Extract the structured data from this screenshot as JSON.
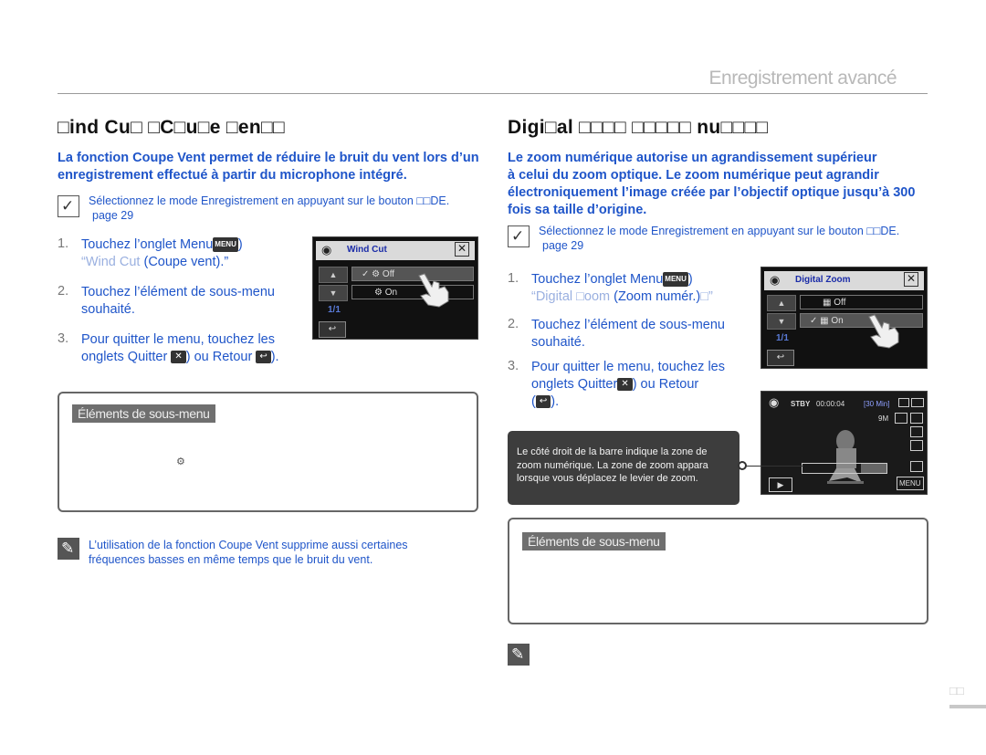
{
  "header": {
    "title": "Enregistrement avancé"
  },
  "left": {
    "title": "□ind Cu□ □C□u□e □en□□",
    "intro_line1": "La fonction Coupe Vent permet de réduire le bruit du vent lors d’un",
    "intro_line2": "enregistrement effectué à partir du microphone intégré.",
    "note1_line1": "Sélectionnez le mode Enregistrement en appuyant sur le bouton □□DE.",
    "note1_line2": "page 29",
    "steps": [
      {
        "num": "1.",
        "a": "Touchez l’onglet Menu",
        "key": "MENU",
        "b": ")",
        "c_thin": "“Wind Cut",
        "c": " (Coupe vent).”"
      },
      {
        "num": "2.",
        "a": "Touchez l’élément de sous-menu",
        "b": "souhaité."
      },
      {
        "num": "3.",
        "a": "Pour quitter le menu, touchez les",
        "b": "onglets Quitter",
        "x": "✕",
        "c": ") ou Retour",
        "back": "↩",
        "d": ")."
      }
    ],
    "screen": {
      "title": "Wind Cut",
      "opt1": "Off",
      "opt2": "On",
      "page": "1/1"
    },
    "submenu_label": "Éléments de sous-menu",
    "note2_line1": "L’utilisation de la fonction Coupe Vent supprime aussi certaines",
    "note2_line2": "fréquences basses en même temps que le bruit du vent."
  },
  "right": {
    "title": "Digi□al □□□□ □□□□□ nu□□□□",
    "intro_line1": "Le zoom numérique autorise un agrandissement supérieur",
    "intro_line2": "à celui du zoom optique. Le zoom numérique peut agrandir",
    "intro_line3": "électroniquement l’image créée par l’objectif optique jusqu’à 300",
    "intro_line4": "fois sa taille d’origine.",
    "note1_line1": "Sélectionnez le mode Enregistrement en appuyant sur le bouton □□DE.",
    "note1_line2": "page 29",
    "steps": [
      {
        "num": "1.",
        "a": "Touchez l’onglet Menu",
        "key": "MENU",
        "b": ")",
        "c_thin": "“Digital □oom",
        "c": " (Zoom numér.)",
        "d_thin": "□”"
      },
      {
        "num": "2.",
        "a": "Touchez l’élément de sous-menu",
        "b": "souhaité."
      },
      {
        "num": "3.",
        "a": "Pour quitter le menu, touchez les",
        "b": "onglets Quitter",
        "x": "✕",
        "c": ") ou Retour",
        "back": "↩",
        "d": ")."
      }
    ],
    "screen": {
      "title": "Digital Zoom",
      "opt1": "Off",
      "opt2": "On",
      "page": "1/1"
    },
    "callout_line1": "Le côté droit de la barre indique la zone de",
    "callout_line2": "zoom numérique. La zone de zoom appara",
    "callout_line3": "lorsque vous déplacez le levier de zoom.",
    "viewfinder": {
      "stby": "STBY",
      "time": "00:00:04",
      "remain": "[30 Min]",
      "size": "9M",
      "menu": "MENU"
    },
    "submenu_label": "Éléments de sous-menu"
  },
  "page_number": "□□"
}
